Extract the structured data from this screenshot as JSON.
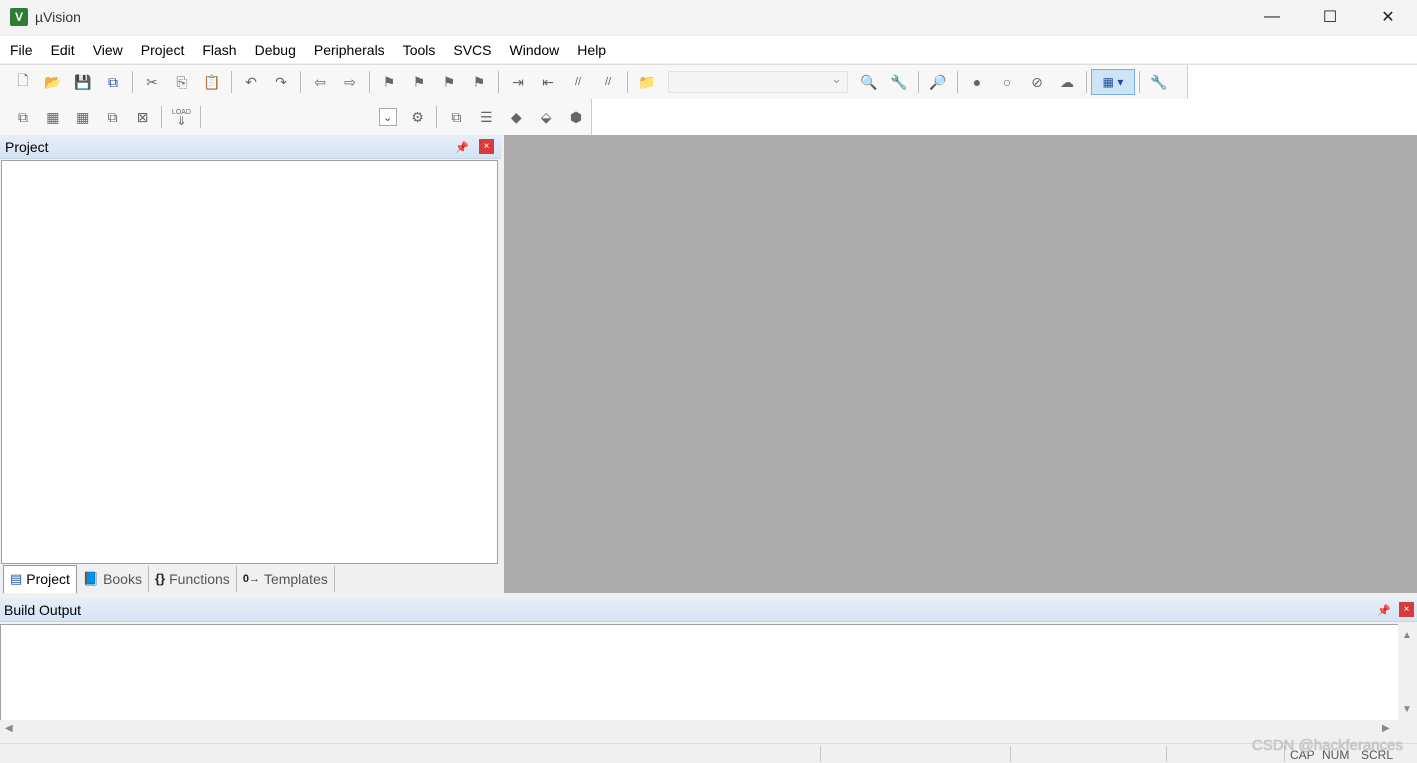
{
  "window": {
    "title": "µVision",
    "app_icon": "V",
    "minimize_icon": "—",
    "maximize_icon": "☐",
    "close_icon": "✕"
  },
  "menu": [
    "File",
    "Edit",
    "View",
    "Project",
    "Flash",
    "Debug",
    "Peripherals",
    "Tools",
    "SVCS",
    "Window",
    "Help"
  ],
  "toolbar1": {
    "icons": {
      "new": "🗋",
      "open": "📂",
      "save": "💾",
      "save_all": "⧉",
      "cut": "✂",
      "copy": "⎘",
      "paste": "📋",
      "undo": "↶",
      "redo": "↷",
      "nav_back": "⇦",
      "nav_forward": "⇨",
      "bookmark": "⚑",
      "bookmark_prev": "⚑",
      "bookmark_next": "⚑",
      "bookmark_clear": "⚑",
      "indent": "⇥",
      "unindent": "⇤",
      "comment": "//",
      "uncomment": "//",
      "find_in_files": "📁",
      "incremental_find": "🔍",
      "find": "🔧",
      "debug": "🔎",
      "breakpoint_insert": "●",
      "breakpoint_enable": "○",
      "breakpoint_disable_all": "⊘",
      "breakpoint_kill_all": "☁",
      "window_view": "▦ ▾",
      "configure": "🔧"
    },
    "find_combo": ""
  },
  "toolbar2": {
    "icons": {
      "translate": "⧉",
      "build": "▦",
      "rebuild": "▦",
      "batch_build": "⧉",
      "stop_build": "⊠",
      "load": "⇓",
      "target_options": "⚙",
      "manage_project": "⧉",
      "manage_multi": "☰",
      "manage_components": "◆",
      "select_packs": "⬙",
      "pack_installer": "⬢"
    },
    "target_drop": "⌄",
    "load_label": "LOAD"
  },
  "project_panel": {
    "title": "Project",
    "pin_icon": "📌",
    "close_icon": "×",
    "tabs": [
      {
        "icon": "▤",
        "label": "Project"
      },
      {
        "icon": "📘",
        "label": "Books"
      },
      {
        "icon": "{}",
        "label": "Functions"
      },
      {
        "icon": "0→",
        "label": "Templates"
      }
    ]
  },
  "build_output": {
    "title": "Build Output",
    "pin_icon": "📌",
    "close_icon": "×",
    "up_arrow": "▲",
    "down_arrow": "▼",
    "left_arrow": "◀",
    "right_arrow": "▶"
  },
  "status": {
    "cap": "CAP",
    "num": "NUM",
    "scrl": "SCRL"
  },
  "watermark": "CSDN @hackferances"
}
